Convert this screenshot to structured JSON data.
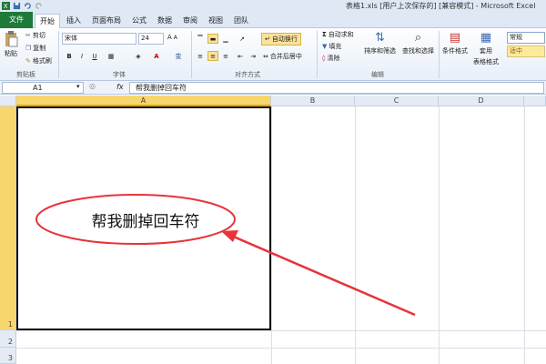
{
  "window": {
    "title": "表格1.xls [用户上次保存的] [兼容模式] - Microsoft Excel"
  },
  "tabs": [
    {
      "label": "文件"
    },
    {
      "label": "开始"
    },
    {
      "label": "插入"
    },
    {
      "label": "页面布局"
    },
    {
      "label": "公式"
    },
    {
      "label": "数据"
    },
    {
      "label": "审阅"
    },
    {
      "label": "视图"
    },
    {
      "label": "团队"
    }
  ],
  "ribbon": {
    "clipboard": {
      "paste": "粘贴",
      "cut": "剪切",
      "copy": "复制",
      "format_painter": "格式刷",
      "label": "剪贴板"
    },
    "font": {
      "name": "宋体",
      "size": "24",
      "bold": "B",
      "italic": "I",
      "underline": "U",
      "font_color_letter": "A",
      "phonetic": "变",
      "label": "字体"
    },
    "alignment": {
      "wrap_text": "自动换行",
      "merge_center": "合并后居中",
      "label": "对齐方式"
    },
    "editing": {
      "autosum": "自动求和",
      "fill": "填充",
      "clear": "清除",
      "sort_filter": "排序和筛选",
      "find_select": "查找和选择",
      "label": "编辑"
    },
    "styles": {
      "conditional_format": "条件格式",
      "format_as_table": "套用",
      "format_as_table_2": "表格格式",
      "normal": "常规",
      "neutral": "适中"
    }
  },
  "formula_bar": {
    "name_box": "A1",
    "fx": "fx",
    "content": "帮我删掉回车符"
  },
  "sheet": {
    "columns": [
      "A",
      "B",
      "C",
      "D"
    ],
    "rows": [
      "1",
      "2",
      "3"
    ],
    "cell_a1": "帮我删掉回车符"
  },
  "colors": {
    "excel_green": "#1f7a3a",
    "selection_header": "#f7d66e",
    "annotation_red": "#e8333a"
  }
}
